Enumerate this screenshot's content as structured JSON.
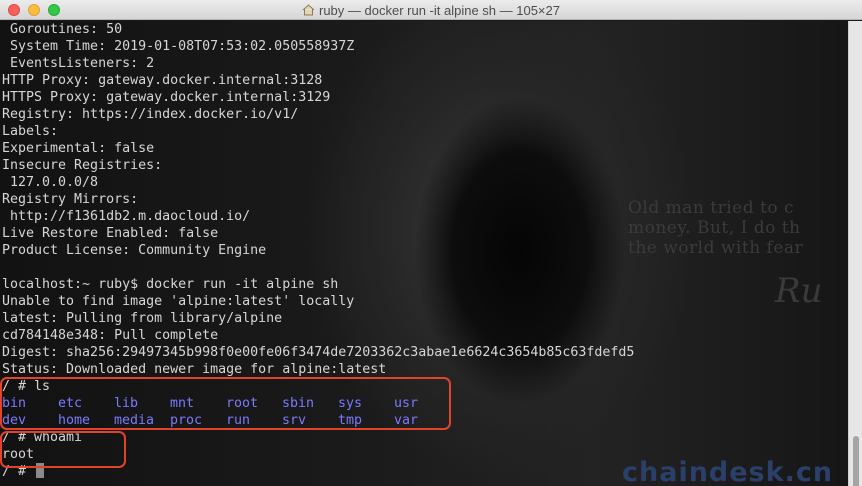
{
  "window": {
    "title": "ruby — docker run -it alpine sh — 105×27"
  },
  "background": {
    "quote_lines": [
      "Old man tried to c",
      "money. But, I do th",
      "the world with fear"
    ],
    "signature": "Ru",
    "watermark": "chaindesk.cn"
  },
  "terminal": {
    "lines": [
      " Goroutines: 50",
      " System Time: 2019-01-08T07:53:02.050558937Z",
      " EventsListeners: 2",
      "HTTP Proxy: gateway.docker.internal:3128",
      "HTTPS Proxy: gateway.docker.internal:3129",
      "Registry: https://index.docker.io/v1/",
      "Labels:",
      "Experimental: false",
      "Insecure Registries:",
      " 127.0.0.0/8",
      "Registry Mirrors:",
      " http://f1361db2.m.daocloud.io/",
      "Live Restore Enabled: false",
      "Product License: Community Engine",
      "",
      "localhost:~ ruby$ docker run -it alpine sh",
      "Unable to find image 'alpine:latest' locally",
      "latest: Pulling from library/alpine",
      "cd784148e348: Pull complete",
      "Digest: sha256:29497345b998f0e00fe06f3474de7203362c3abae1e6624c3654b85c63fdefd5",
      "Status: Downloaded newer image for alpine:latest",
      "/ # ls"
    ],
    "ls_row1": [
      "bin",
      "etc",
      "lib",
      "mnt",
      "root",
      "sbin",
      "sys",
      "usr"
    ],
    "ls_row2": [
      "dev",
      "home",
      "media",
      "proc",
      "run",
      "srv",
      "tmp",
      "var"
    ],
    "whoami_cmd": "/ # whoami",
    "whoami_out": "root",
    "prompt": "/ # "
  },
  "colors": {
    "dir_color": "#7b79ff",
    "highlight": "#e0442d"
  }
}
